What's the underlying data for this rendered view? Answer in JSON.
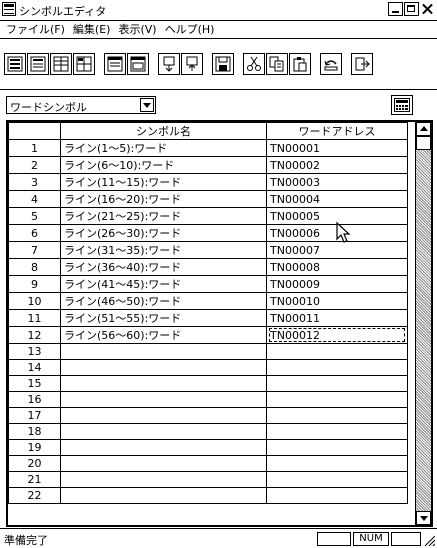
{
  "window": {
    "title": "シンボルエディタ"
  },
  "menu": [
    {
      "label": "ファイル(F)"
    },
    {
      "label": "編集(E)"
    },
    {
      "label": "表示(V)"
    },
    {
      "label": "ヘルプ(H)"
    }
  ],
  "symbol_type": {
    "selected": "ワードシンボル"
  },
  "grid": {
    "headers": [
      "",
      "シンボル名",
      "ワードアドレス"
    ],
    "rows": [
      {
        "no": "1",
        "name": "ライン(1～5):ワード",
        "address": "TN00001"
      },
      {
        "no": "2",
        "name": "ライン(6～10):ワード",
        "address": "TN00002"
      },
      {
        "no": "3",
        "name": "ライン(11～15):ワード",
        "address": "TN00003"
      },
      {
        "no": "4",
        "name": "ライン(16～20):ワード",
        "address": "TN00004"
      },
      {
        "no": "5",
        "name": "ライン(21～25):ワード",
        "address": "TN00005"
      },
      {
        "no": "6",
        "name": "ライン(26～30):ワード",
        "address": "TN00006"
      },
      {
        "no": "7",
        "name": "ライン(31～35):ワード",
        "address": "TN00007"
      },
      {
        "no": "8",
        "name": "ライン(36～40):ワード",
        "address": "TN00008"
      },
      {
        "no": "9",
        "name": "ライン(41～45):ワード",
        "address": "TN00009"
      },
      {
        "no": "10",
        "name": "ライン(46～50):ワード",
        "address": "TN00010"
      },
      {
        "no": "11",
        "name": "ライン(51～55):ワード",
        "address": "TN00011"
      },
      {
        "no": "12",
        "name": "ライン(56～60):ワード",
        "address": "TN00012"
      },
      {
        "no": "13",
        "name": "",
        "address": ""
      },
      {
        "no": "14",
        "name": "",
        "address": ""
      },
      {
        "no": "15",
        "name": "",
        "address": ""
      },
      {
        "no": "16",
        "name": "",
        "address": ""
      },
      {
        "no": "17",
        "name": "",
        "address": ""
      },
      {
        "no": "18",
        "name": "",
        "address": ""
      },
      {
        "no": "19",
        "name": "",
        "address": ""
      },
      {
        "no": "20",
        "name": "",
        "address": ""
      },
      {
        "no": "21",
        "name": "",
        "address": ""
      },
      {
        "no": "22",
        "name": "",
        "address": ""
      }
    ]
  },
  "status": {
    "text": "準備完了",
    "num": "NUM"
  },
  "icons": {
    "toolbar": [
      "list-view-icon",
      "list-view-alt-icon",
      "split-view-icon",
      "split-view-alt-icon",
      "window-icon",
      "window-alt-icon",
      "download-icon",
      "upload-icon",
      "save-icon",
      "cut-icon",
      "copy-icon",
      "paste-icon",
      "undo-icon",
      "exit-icon"
    ]
  }
}
